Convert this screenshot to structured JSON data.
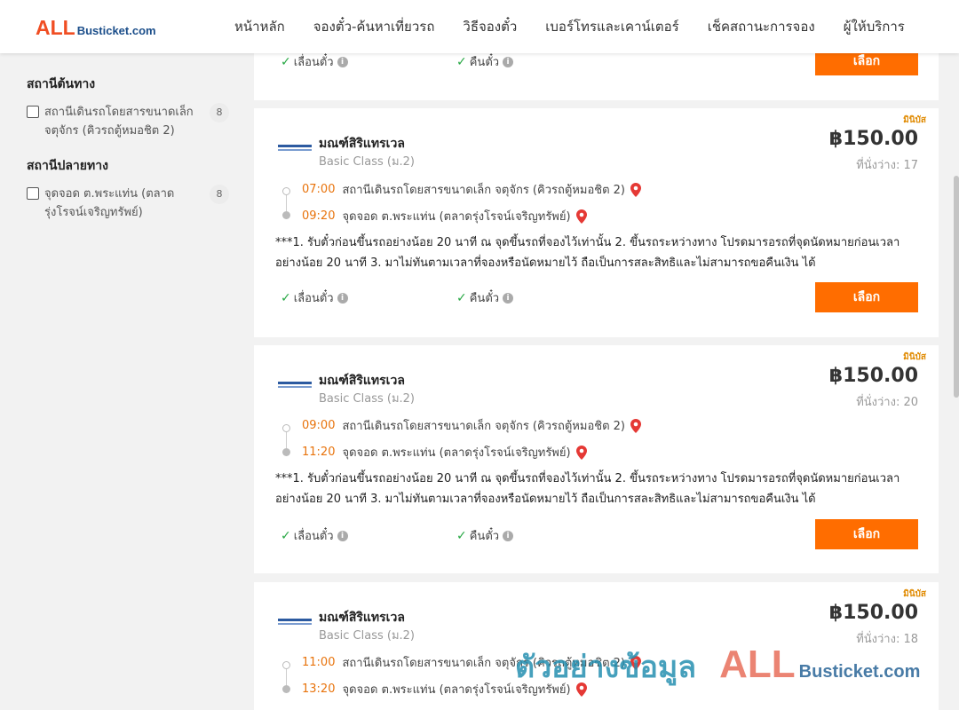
{
  "header": {
    "logo_all": "ALL",
    "logo_rest": "Busticket.com",
    "nav": [
      "หน้าหลัก",
      "จองตั๋ว-ค้นหาเที่ยวรถ",
      "วิธีจองตั๋ว",
      "เบอร์โทรและเคาน์เตอร์",
      "เช็คสถานะการจอง",
      "ผู้ให้บริการ"
    ]
  },
  "sidebar": {
    "origin_title": "สถานีต้นทาง",
    "origin_label": "สถานีเดินรถโดยสารขนาดเล็ก จตุจักร (คิวรถตู้หมอชิต 2)",
    "origin_count": "8",
    "dest_title": "สถานีปลายทาง",
    "dest_label": "จุดจอด ต.พระแท่น (ตลาดรุ่งโรจน์เจริญทรัพย์)",
    "dest_count": "8"
  },
  "top_card": {
    "feature_1": "เลื่อนตั๋ว",
    "feature_2": "คืนตั๋ว",
    "select_label": "เลือก"
  },
  "trips": [
    {
      "badge": "มินิบัส",
      "operator": "มณฑ์สิริแทรเวล",
      "class": "Basic Class (ม.2)",
      "price": "฿150.00",
      "seats": "ที่นั่งว่าง: 17",
      "depart_time": "07:00",
      "depart_station": "สถานีเดินรถโดยสารขนาดเล็ก จตุจักร (คิวรถตู้หมอชิต 2)",
      "arrive_time": "09:20",
      "arrive_station": "จุดจอด ต.พระแท่น (ตลาดรุ่งโรจน์เจริญทรัพย์)",
      "notice": "***1. รับตั๋วก่อนขึ้นรถอย่างน้อย 20 นาที ณ จุดขึ้นรถที่จองไว้เท่านั้น 2. ขึ้นรถระหว่างทาง โปรดมารอรถที่จุดนัดหมายก่อนเวลาอย่างน้อย 20 นาที 3. มาไม่ทันตามเวลาที่จองหรือนัดหมายไว้ ถือเป็นการสละสิทธิและไม่สามารถขอคืนเงิน ได้",
      "feature_1": "เลื่อนตั๋ว",
      "feature_2": "คืนตั๋ว",
      "select_label": "เลือก"
    },
    {
      "badge": "มินิบัส",
      "operator": "มณฑ์สิริแทรเวล",
      "class": "Basic Class (ม.2)",
      "price": "฿150.00",
      "seats": "ที่นั่งว่าง: 20",
      "depart_time": "09:00",
      "depart_station": "สถานีเดินรถโดยสารขนาดเล็ก จตุจักร (คิวรถตู้หมอชิต 2)",
      "arrive_time": "11:20",
      "arrive_station": "จุดจอด ต.พระแท่น (ตลาดรุ่งโรจน์เจริญทรัพย์)",
      "notice": "***1. รับตั๋วก่อนขึ้นรถอย่างน้อย 20 นาที ณ จุดขึ้นรถที่จองไว้เท่านั้น 2. ขึ้นรถระหว่างทาง โปรดมารอรถที่จุดนัดหมายก่อนเวลาอย่างน้อย 20 นาที 3. มาไม่ทันตามเวลาที่จองหรือนัดหมายไว้ ถือเป็นการสละสิทธิและไม่สามารถขอคืนเงิน ได้",
      "feature_1": "เลื่อนตั๋ว",
      "feature_2": "คืนตั๋ว",
      "select_label": "เลือก"
    },
    {
      "badge": "มินิบัส",
      "operator": "มณฑ์สิริแทรเวล",
      "class": "Basic Class (ม.2)",
      "price": "฿150.00",
      "seats": "ที่นั่งว่าง: 18",
      "depart_time": "11:00",
      "depart_station": "สถานีเดินรถโดยสารขนาดเล็ก จตุจักร (คิวรถตู้หมอชิต 2)",
      "arrive_time": "13:20",
      "arrive_station": "จุดจอด ต.พระแท่น (ตลาดรุ่งโรจน์เจริญทรัพย์)"
    }
  ],
  "watermark": {
    "thai": "ตัวอย่างข้อมูล",
    "all": "ALL",
    "rest": "Busticket.com"
  },
  "colors": {
    "accent": "#ff6d00",
    "time": "#e8730c",
    "check": "#27a844",
    "pin": "#e53935"
  }
}
